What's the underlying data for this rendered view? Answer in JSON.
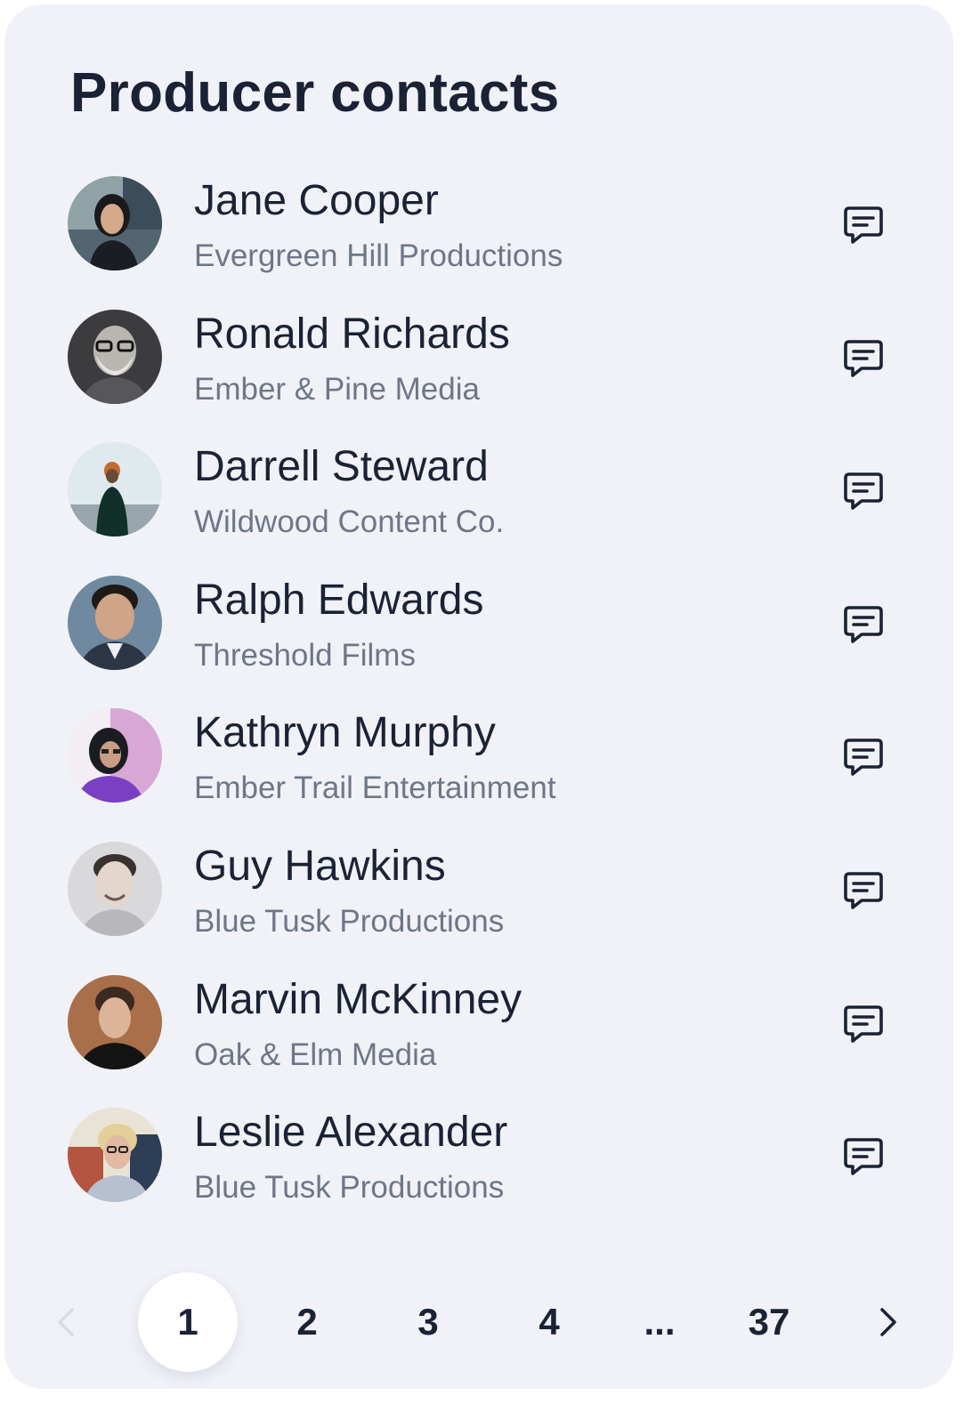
{
  "title": "Producer contacts",
  "contacts": [
    {
      "name": "Jane Cooper",
      "company": "Evergreen Hill Productions"
    },
    {
      "name": "Ronald Richards",
      "company": "Ember & Pine Media"
    },
    {
      "name": "Darrell Steward",
      "company": "Wildwood Content Co."
    },
    {
      "name": "Ralph Edwards",
      "company": "Threshold Films"
    },
    {
      "name": "Kathryn Murphy",
      "company": "Ember Trail Entertainment"
    },
    {
      "name": "Guy Hawkins",
      "company": "Blue Tusk Productions"
    },
    {
      "name": "Marvin McKinney",
      "company": "Oak & Elm Media"
    },
    {
      "name": "Leslie Alexander",
      "company": "Blue Tusk Productions"
    }
  ],
  "row_icon": "message-icon",
  "pagination": {
    "pages": [
      "1",
      "2",
      "3",
      "4",
      "...",
      "37"
    ],
    "current": "1",
    "prev_icon": "chevron-left-icon",
    "next_icon": "chevron-right-icon"
  },
  "colors": {
    "card_background": "#f1f2f8",
    "text_primary": "#1b2235",
    "text_secondary": "#6e7687",
    "active_page_background": "#ffffff"
  }
}
